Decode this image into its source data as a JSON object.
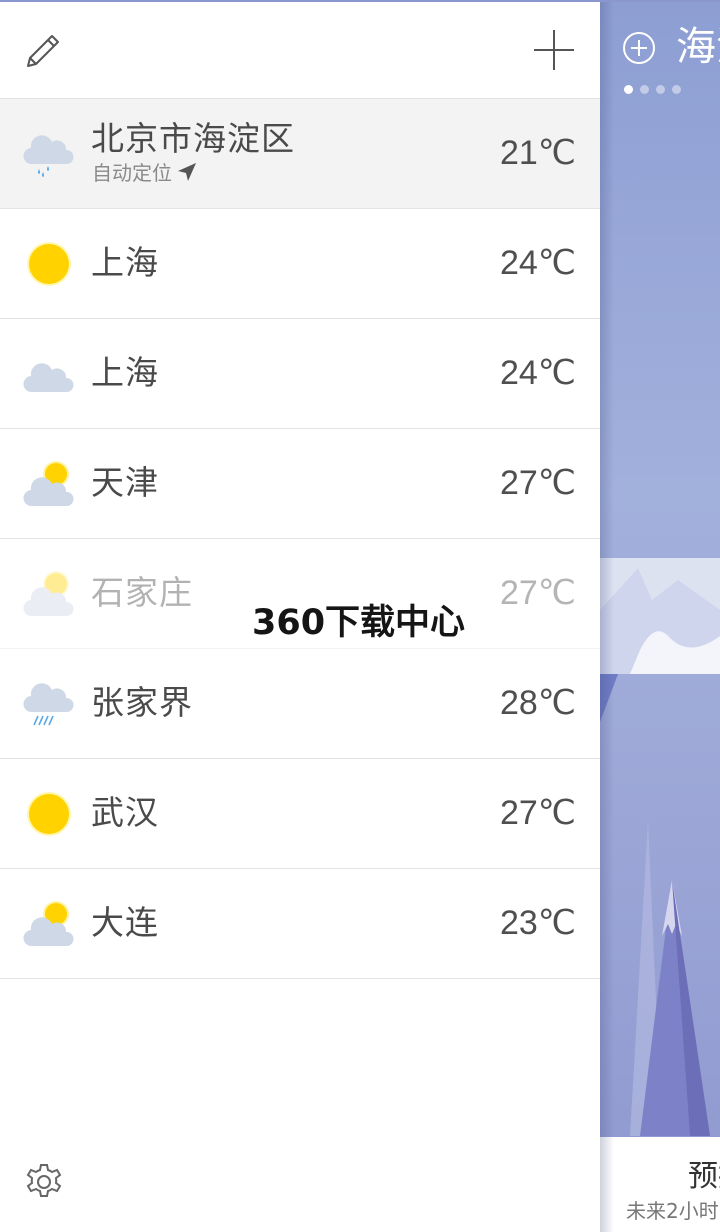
{
  "list": {
    "cities": [
      {
        "name": "北京市海淀区",
        "sub": "自动定位",
        "temp": "21℃",
        "icon": "cloud-rain-icon",
        "current": true,
        "faded": false
      },
      {
        "name": "上海",
        "temp": "24℃",
        "icon": "sun-icon",
        "current": false,
        "faded": false
      },
      {
        "name": "上海",
        "temp": "24℃",
        "icon": "cloud-icon",
        "current": false,
        "faded": false
      },
      {
        "name": "天津",
        "temp": "27℃",
        "icon": "partly-cloudy-icon",
        "current": false,
        "faded": false
      },
      {
        "name": "石家庄",
        "temp": "27℃",
        "icon": "partly-cloudy-icon",
        "current": false,
        "faded": true
      },
      {
        "name": "张家界",
        "temp": "28℃",
        "icon": "cloud-heavy-rain-icon",
        "current": false,
        "faded": false
      },
      {
        "name": "武汉",
        "temp": "27℃",
        "icon": "sun-icon",
        "current": false,
        "faded": false
      },
      {
        "name": "大连",
        "temp": "23℃",
        "icon": "partly-cloudy-icon",
        "current": false,
        "faded": false
      }
    ]
  },
  "watermark": "360下载中心",
  "right_panel": {
    "city": "海淀",
    "forecast_title": "预报",
    "forecast_sub": "未来2小时",
    "page_count": 4,
    "active_page": 0
  },
  "colors": {
    "accent": "#8d9ed3",
    "sun": "#ffd200",
    "cloud": "#cfd8e6",
    "rain": "#5aa9e6"
  }
}
